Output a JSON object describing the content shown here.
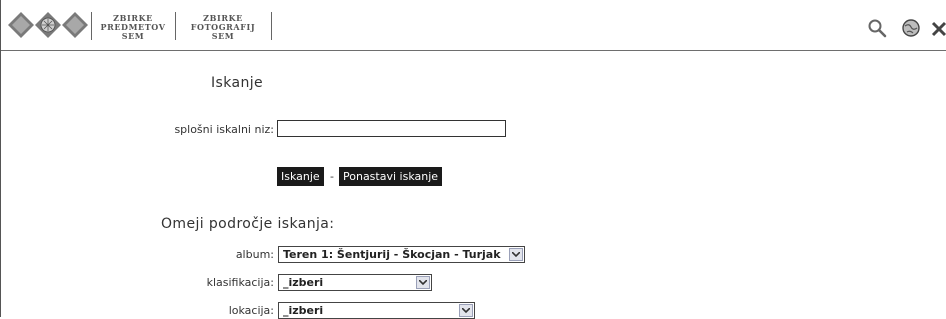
{
  "header": {
    "logo_icon": "diamond-cluster-logo",
    "collections": [
      {
        "lines": [
          "ZBIRKE",
          "PREDMETOV",
          "SEM"
        ]
      },
      {
        "lines": [
          "ZBIRKE",
          "FOTOGRAFIJ",
          "SEM"
        ]
      }
    ],
    "icons": [
      "search-icon",
      "globe-icon",
      "close-icon"
    ]
  },
  "search": {
    "heading": "Iskanje",
    "general_label": "splošni iskalni niz:",
    "general_value": "",
    "search_button": "Iskanje",
    "separator": "-",
    "reset_button": "Ponastavi iskanje"
  },
  "filters": {
    "heading": "Omeji področje iskanja:",
    "album": {
      "label": "album:",
      "value": "Teren 1: Šentjurij - Škocjan - Turjak"
    },
    "klasifikacija": {
      "label": "klasifikacija:",
      "value": "_izberi"
    },
    "lokacija": {
      "label": "lokacija:",
      "value": "_izberi"
    }
  },
  "colors": {
    "button_bg": "#1a1a1a",
    "button_text": "#ffffff",
    "text": "#333333"
  }
}
